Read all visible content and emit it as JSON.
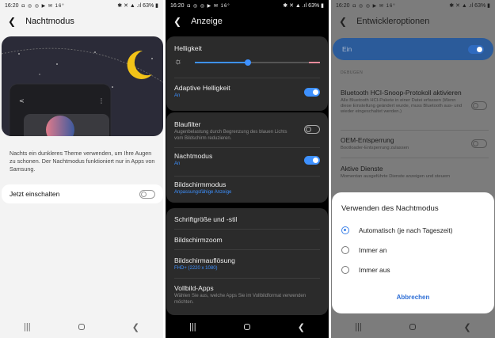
{
  "status_bar": {
    "time": "16:20",
    "icons": "◘ ◎ ◎ ▶ ✉ 16°",
    "right": "✱ ✕ ▲ .ıl 63% ▮"
  },
  "panel1": {
    "title": "Nachtmodus",
    "description": "Nachts ein dunkleres Theme verwenden, um Ihre Augen zu schonen. Der Nachtmodus funktioniert nur in Apps von Samsung.",
    "toggle_label": "Jetzt einschalten",
    "toggle_on": false
  },
  "panel2": {
    "title": "Anzeige",
    "brightness_label": "Helligkeit",
    "brightness_level": 0.45,
    "adaptive_label": "Adaptive Helligkeit",
    "adaptive_sub": "An",
    "bluefilter_label": "Blaufilter",
    "bluefilter_sub": "Augenbelastung durch Begrenzung des blauen Lichts vom Bildschirm reduzieren.",
    "nightmode_label": "Nachtmodus",
    "nightmode_sub": "An",
    "screenmode_label": "Bildschirmmodus",
    "screenmode_sub": "Anpassungsfähige Anzeige",
    "fontsize_label": "Schriftgröße und -stil",
    "zoom_label": "Bildschirmzoom",
    "resolution_label": "Bildschirmauflösung",
    "resolution_sub": "FHD+ (2220 x 1080)",
    "fullscreen_label": "Vollbild-Apps",
    "fullscreen_sub": "Wählen Sie aus, welche Apps Sie im Vollbildformat verwenden möchten."
  },
  "panel3": {
    "title": "Entwickleroptionen",
    "master_label": "Ein",
    "section_label": "DEBUGEN",
    "items": [
      {
        "title": "Bluetooth HCI-Snoop-Protokoll aktivieren",
        "sub": "Alle Bluetooth HCI-Pakete in einer Datei erfassen (Wenn diese Einstellung geändert wurde, muss Bluetooth aus- und wieder eingeschaltet werden.)"
      },
      {
        "title": "OEM-Entsperrung",
        "sub": "Bootloader-Entsperrung zulassen"
      },
      {
        "title": "Aktive Dienste",
        "sub": "Momentan ausgeführte Dienste anzeigen und steuern"
      }
    ],
    "dialog": {
      "title": "Verwenden des Nachtmodus",
      "options": [
        "Automatisch (je nach Tageszeit)",
        "Immer an",
        "Immer aus"
      ],
      "selected_index": 0,
      "cancel_label": "Abbrechen"
    }
  },
  "colors": {
    "accent": "#3e91ff",
    "moon": "#f2c318",
    "illustration_bg": "#2b2b38"
  }
}
